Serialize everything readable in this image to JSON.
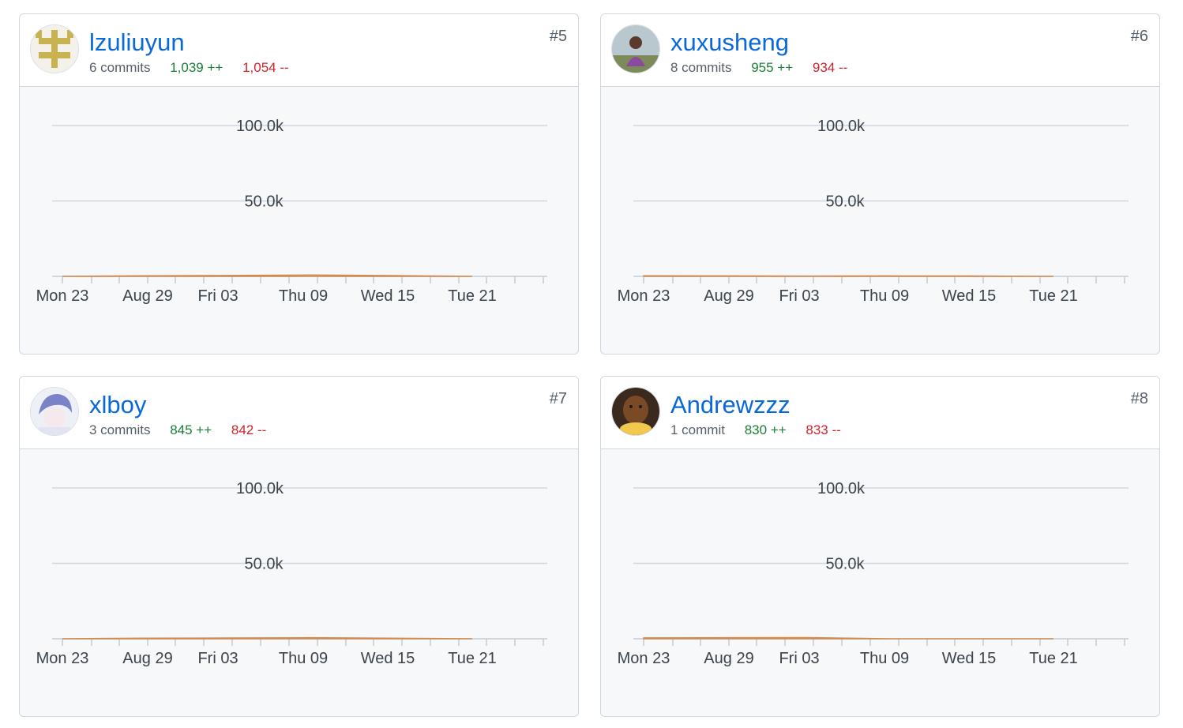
{
  "contributors": [
    {
      "username": "lzuliuyun",
      "rank": "#5",
      "commits": "6 commits",
      "additions": "1,039 ++",
      "deletions": "1,054 --",
      "avatar_icon": "yellow-cross-avatar-icon",
      "chart_data": {
        "type": "area",
        "x": [
          "Mon 23",
          "Aug 29",
          "Fri 03",
          "Thu 09",
          "Wed 15",
          "Tue 21"
        ],
        "y_ticks": [
          "50.0k",
          "100.0k"
        ],
        "ylim": [
          0,
          100000
        ],
        "series": [
          {
            "values": [
              0,
              400,
              600,
              900,
              500,
              0
            ]
          }
        ],
        "grid": true
      }
    },
    {
      "username": "xuxusheng",
      "rank": "#6",
      "commits": "8 commits",
      "additions": "955 ++",
      "deletions": "934 --",
      "avatar_icon": "person-photo-avatar-icon",
      "chart_data": {
        "type": "area",
        "x": [
          "Mon 23",
          "Aug 29",
          "Fri 03",
          "Thu 09",
          "Wed 15",
          "Tue 21"
        ],
        "y_ticks": [
          "50.0k",
          "100.0k"
        ],
        "ylim": [
          0,
          100000
        ],
        "series": [
          {
            "values": [
              400,
              300,
              200,
              300,
              250,
              0
            ]
          }
        ],
        "grid": true
      }
    },
    {
      "username": "xlboy",
      "rank": "#7",
      "commits": "3 commits",
      "additions": "845 ++",
      "deletions": "842 --",
      "avatar_icon": "anime-character-avatar-icon",
      "chart_data": {
        "type": "area",
        "x": [
          "Mon 23",
          "Aug 29",
          "Fri 03",
          "Thu 09",
          "Wed 15",
          "Tue 21"
        ],
        "y_ticks": [
          "50.0k",
          "100.0k"
        ],
        "ylim": [
          0,
          100000
        ],
        "series": [
          {
            "values": [
              0,
              400,
              500,
              700,
              400,
              0
            ]
          }
        ],
        "grid": true
      }
    },
    {
      "username": "Andrewzzz",
      "rank": "#8",
      "commits": "1 commit",
      "additions": "830 ++",
      "deletions": "833 --",
      "avatar_icon": "bear-photo-avatar-icon",
      "chart_data": {
        "type": "area",
        "x": [
          "Mon 23",
          "Aug 29",
          "Fri 03",
          "Thu 09",
          "Wed 15",
          "Tue 21"
        ],
        "y_ticks": [
          "50.0k",
          "100.0k"
        ],
        "ylim": [
          0,
          100000
        ],
        "series": [
          {
            "values": [
              600,
              700,
              800,
              0,
              0,
              0
            ]
          }
        ],
        "grid": true
      }
    }
  ],
  "colors": {
    "link": "#0969da",
    "additions": "#1a7f37",
    "deletions": "#cf222e",
    "area_fill": "#f4d7b8",
    "area_stroke": "#d18a52",
    "grid": "#d0d7de",
    "tick_label": "#3b434b"
  }
}
